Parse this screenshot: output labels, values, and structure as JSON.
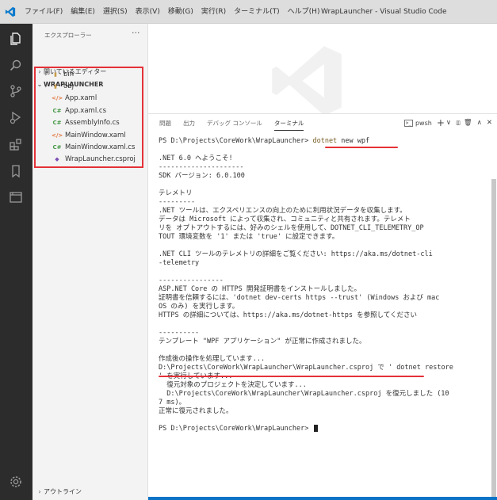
{
  "window": {
    "title": "WrapLauncher - Visual Studio Code",
    "menu": [
      "ファイル(F)",
      "編集(E)",
      "選択(S)",
      "表示(V)",
      "移動(G)",
      "実行(R)",
      "ターミナル(T)",
      "ヘルプ(H)"
    ]
  },
  "activity_bar": [
    "explorer-icon",
    "search-icon",
    "source-control-icon",
    "run-debug-icon",
    "extensions-icon",
    "bookmark-icon",
    "remote-explorer-icon",
    "manage-gear-icon"
  ],
  "sidebar": {
    "header": "エクスプローラー",
    "more": "···",
    "open_editors": "開いているエディター",
    "project": "WRAPLAUNCHER",
    "items": [
      {
        "label": "bin",
        "icon": "folder-icon",
        "glyph": "▮"
      },
      {
        "label": "obj",
        "icon": "folder-icon",
        "glyph": "▮"
      },
      {
        "label": "App.xaml",
        "icon": "xaml-icon",
        "glyph": "</>"
      },
      {
        "label": "App.xaml.cs",
        "icon": "csharp-icon",
        "glyph": "C#"
      },
      {
        "label": "AssemblyInfo.cs",
        "icon": "csharp-icon",
        "glyph": "C#"
      },
      {
        "label": "MainWindow.xaml",
        "icon": "xaml-icon",
        "glyph": "</>"
      },
      {
        "label": "MainWindow.xaml.cs",
        "icon": "csharp-icon",
        "glyph": "C#"
      },
      {
        "label": "WrapLauncher.csproj",
        "icon": "csproj-icon",
        "glyph": "◆"
      }
    ],
    "outline": "アウトライン"
  },
  "panel": {
    "tabs": [
      "問題",
      "出力",
      "デバッグ コンソール",
      "ターミナル"
    ],
    "active_tab": "ターミナル",
    "shell": "pwsh",
    "controls": [
      "+",
      "∨",
      "▯▯",
      "🗑",
      "∧",
      "✕"
    ]
  },
  "terminal": {
    "prompt": "PS D:\\Projects\\CoreWork\\WrapLauncher> ",
    "command": {
      "cmd": "dotnet",
      "args": " new wpf"
    },
    "lines": [
      "",
      ".NET 6.0 へようこそ!",
      "---------------------",
      "SDK バージョン: 6.0.100",
      "",
      "テレメトリ",
      "---------",
      ".NET ツールは、エクスペリエンスの向上のために利用状況データを収集します。",
      "データは Microsoft によって収集され、コミュニティと共有されます。テレメト",
      "リを オプトアウトするには、好みのシェルを使用して、DOTNET_CLI_TELEMETRY_OP",
      "TOUT 環境変数を '1' または 'true' に設定できます。",
      "",
      ".NET CLI ツールのテレメトリの詳細をご覧ください: https://aka.ms/dotnet-cli",
      "-telemetry",
      "",
      "----------------",
      "ASP.NET Core の HTTPS 開発証明書をインストールしました。",
      "証明書を信頼するには、'dotnet dev-certs https --trust' (Windows および mac",
      "OS のみ) を実行します。",
      "HTTPS の詳細については、https://aka.ms/dotnet-https を参照してください",
      "",
      "----------",
      "テンプレート \"WPF アプリケーション\" が正常に作成されました。",
      "",
      "作成後の操作を処理しています...",
      "D:\\Projects\\CoreWork\\WrapLauncher\\WrapLauncher.csproj で ' dotnet restore",
      "' を実行しています...",
      "  復元対象のプロジェクトを決定しています...",
      "  D:\\Projects\\CoreWork\\WrapLauncher\\WrapLauncher.csproj を復元しました (10",
      "7 ms)。",
      "正常に復元されました。",
      ""
    ],
    "final_prompt": "PS D:\\Projects\\CoreWork\\WrapLauncher> "
  }
}
